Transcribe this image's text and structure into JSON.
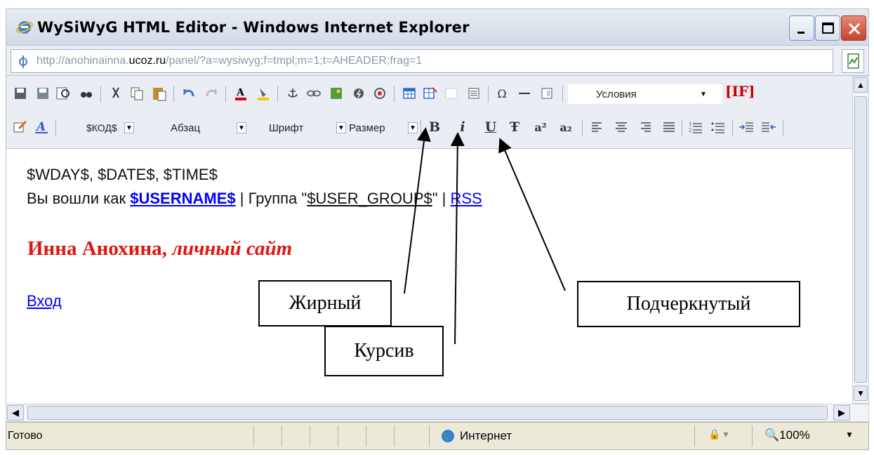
{
  "window": {
    "title": "WySiWyG HTML Editor - Windows Internet Explorer"
  },
  "address": {
    "prefix": "http://anohinainna.",
    "host": "ucoz.ru",
    "path": "/panel/?a=wysiwyg;f=tmpl;m=1;t=AHEADER;frag=1"
  },
  "toolbar": {
    "conditions_select": "Условия",
    "if_button": "[IF]",
    "code_select": "$КОД$",
    "paragraph_select": "Абзац",
    "font_select": "Шрифт",
    "size_select": "Размер",
    "bold": "B",
    "italic": "i",
    "underline": "U",
    "strike": "Ŧ",
    "sup": "a²",
    "sub": "a₂",
    "omega": "Ω"
  },
  "content": {
    "line1": "$WDAY$, $DATE$, $TIME$",
    "line2_prefix": "Вы вошли как ",
    "username": "$USERNAME$",
    "line2_mid": " | Группа \"",
    "user_group": "$USER_GROUP$",
    "line2_suffix": "\" | ",
    "rss": "RSS",
    "heading_plain": "Инна Анохина, ",
    "heading_italic": "личный сайт",
    "login_link": "Вход"
  },
  "status": {
    "text": "Готово",
    "zone": "Интернет",
    "zoom": "100%"
  },
  "callouts": {
    "bold": "Жирный",
    "italic": "Курсив",
    "underline": "Подчеркнутый"
  },
  "colors": {
    "heading": "#e0150f",
    "link": "#0000ff",
    "close_button": "#c4422c"
  }
}
